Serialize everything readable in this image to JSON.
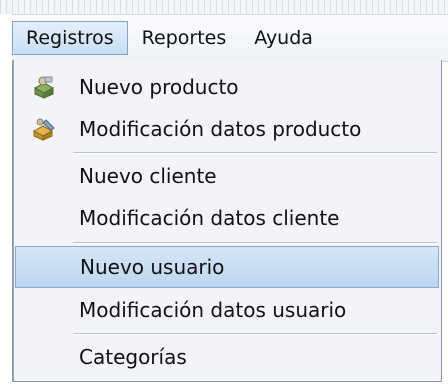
{
  "menubar": {
    "items": [
      {
        "label": "Registros"
      },
      {
        "label": "Reportes"
      },
      {
        "label": "Ayuda"
      }
    ]
  },
  "dropdown": {
    "items": [
      {
        "label": "Nuevo producto",
        "icon": "package-icon"
      },
      {
        "label": "Modificación datos producto",
        "icon": "edit-package-icon"
      },
      {
        "label": "Nuevo cliente"
      },
      {
        "label": "Modificación datos cliente"
      },
      {
        "label": "Nuevo usuario"
      },
      {
        "label": "Modificación datos usuario"
      },
      {
        "label": "Categorías"
      }
    ]
  },
  "colors": {
    "highlight": "#c9def3",
    "highlight_border": "#86acd6",
    "menu_background": "#f2f4f7"
  }
}
